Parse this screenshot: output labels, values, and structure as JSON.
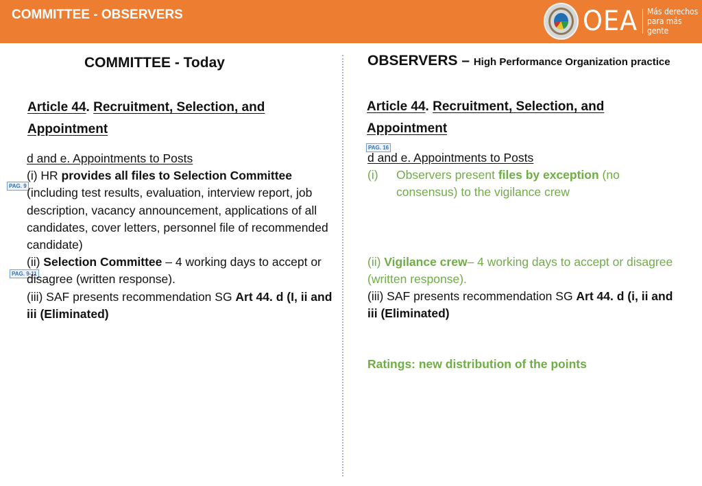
{
  "header": {
    "title": "COMMITTEE - OBSERVERS",
    "logo": {
      "seal_icon": "oas-seal-icon",
      "name": "OEA",
      "tagline_line1": "Más derechos",
      "tagline_line2": "para más gente"
    }
  },
  "left": {
    "title": "COMMITTEE - Today",
    "article_label": "Article 44",
    "article_sep": ".",
    "article_title_1": "Recruitment, Selection, and",
    "article_title_2": "Appointment",
    "section": "d and e. Appointments to Posts",
    "item1_prefix": "(i) HR ",
    "item1_bold": "provides all files  to Selection Committee",
    "item1_rest": "(including test results, evaluation, interview report, job description, vacancy announcement, applications of all candidates, cover letters, personnel file of recommended candidate)",
    "item2_prefix": "(ii) ",
    "item2_bold": "Selection Committee",
    "item2_rest": " – 4 working days to accept or disagree (written response).",
    "item3_prefix": "(iii) SAF presents recommendation SG ",
    "item3_bold": "Art 44. d (I, ii and iii (Eliminated)",
    "tags": [
      "PAG. 9",
      "PAG. 9-11"
    ]
  },
  "right": {
    "title": "OBSERVERS – ",
    "subtitle": "High Performance Organization practice",
    "article_label": "Article 44",
    "article_sep": ".",
    "article_title_1": "Recruitment, Selection, and",
    "article_title_2": "Appointment",
    "tag": "PAG. 16",
    "section": "d and e. Appointments to Posts",
    "item1_num": "(i)",
    "item1_prefix": "Observers present ",
    "item1_bold": "files by exception",
    "item1_rest": " (no consensus) to the vigilance crew",
    "item2_prefix": "(ii) ",
    "item2_bold": "Vigilance crew",
    "item2_rest": "– 4 working days to accept or disagree (written response).",
    "item3_prefix": "(iii) SAF presents recommendation SG ",
    "item3_bold": "Art 44. d (i, ii and iii (Eliminated)",
    "ratings": "Ratings: new distribution of the points"
  },
  "colors": {
    "header_bg": "#ed7d31",
    "accent_green": "#70ad47",
    "tag_blue": "#2f6fc0"
  }
}
